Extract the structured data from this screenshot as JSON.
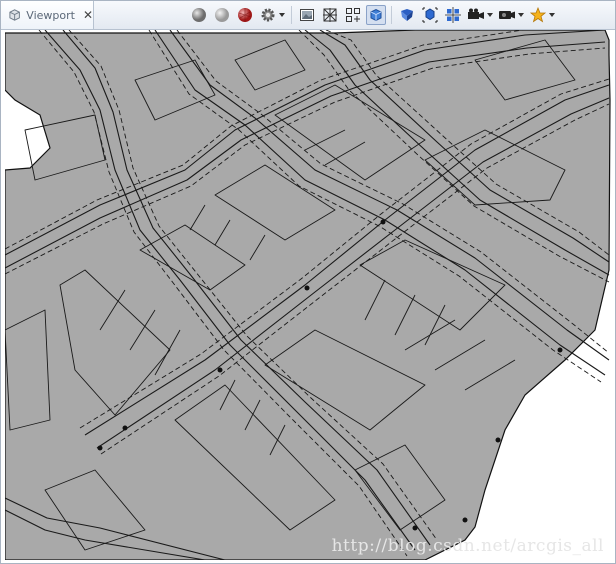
{
  "tab": {
    "title": "Viewport",
    "icon": "viewport-cube-icon",
    "close_icon": "close-icon"
  },
  "toolbar": {
    "buttons": [
      {
        "name": "shading-flat-sphere-icon",
        "dropdown": false
      },
      {
        "name": "shading-smooth-sphere-icon",
        "dropdown": false
      },
      {
        "name": "texture-sphere-icon",
        "dropdown": false
      },
      {
        "name": "render-settings-gear-icon",
        "dropdown": true
      },
      {
        "name": "background-image-icon",
        "dropdown": false
      },
      {
        "name": "wireframe-toggle-icon",
        "dropdown": false
      },
      {
        "name": "grid-toggle-icon",
        "dropdown": false
      },
      {
        "name": "selection-cube-icon",
        "dropdown": false,
        "pressed": true
      },
      {
        "name": "navigate-icon",
        "dropdown": false
      },
      {
        "name": "frame-selection-icon",
        "dropdown": false
      },
      {
        "name": "frame-all-icon",
        "dropdown": false
      },
      {
        "name": "camera-icon",
        "dropdown": true
      },
      {
        "name": "camera-bookmark-icon",
        "dropdown": true
      },
      {
        "name": "bookmarks-star-icon",
        "dropdown": true
      }
    ]
  },
  "scene": {
    "ground_color": "#a9a9a9",
    "line_color": "#111111",
    "background": "#ffffff"
  },
  "watermark": "http://blog.csdn.net/arcgis_all"
}
